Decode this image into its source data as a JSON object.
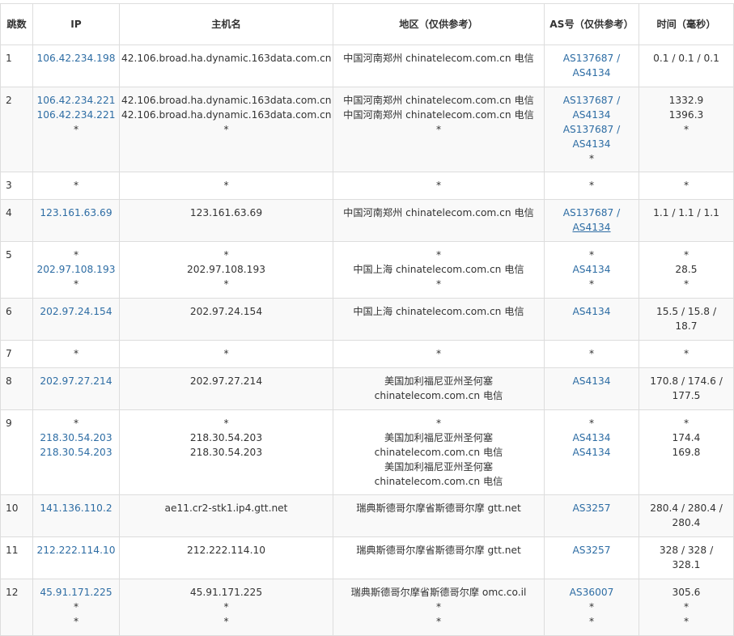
{
  "headers": {
    "hop": "跳数",
    "ip": "IP",
    "host": "主机名",
    "region": "地区（仅供参考）",
    "asn": "AS号（仅供参考）",
    "time": "时间（毫秒）"
  },
  "rows": [
    {
      "hop": "1",
      "ip": [
        "106.42.234.198"
      ],
      "host": [
        "42.106.broad.ha.dynamic.163data.com.cn"
      ],
      "region": [
        "中国河南郑州 chinatelecom.com.cn 电信"
      ],
      "asn": [
        "AS137687 /",
        "AS4134"
      ],
      "time": [
        "0.1 / 0.1 / 0.1"
      ]
    },
    {
      "hop": "2",
      "ip": [
        "106.42.234.221",
        "106.42.234.221",
        "*"
      ],
      "host": [
        "42.106.broad.ha.dynamic.163data.com.cn",
        "42.106.broad.ha.dynamic.163data.com.cn",
        "*"
      ],
      "region": [
        "中国河南郑州 chinatelecom.com.cn 电信",
        "中国河南郑州 chinatelecom.com.cn 电信",
        "*"
      ],
      "asn": [
        "AS137687 /",
        "AS4134",
        "AS137687 /",
        "AS4134",
        "*"
      ],
      "time": [
        "1332.9",
        "1396.3",
        "*"
      ]
    },
    {
      "hop": "3",
      "ip": [
        "*"
      ],
      "host": [
        "*"
      ],
      "region": [
        "*"
      ],
      "asn": [
        "*"
      ],
      "time": [
        "*"
      ]
    },
    {
      "hop": "4",
      "ip": [
        "123.161.63.69"
      ],
      "host": [
        "123.161.63.69"
      ],
      "region": [
        "中国河南郑州 chinatelecom.com.cn 电信"
      ],
      "asn": [
        "AS137687 /",
        "AS4134"
      ],
      "time": [
        "1.1 / 1.1 / 1.1"
      ]
    },
    {
      "hop": "5",
      "ip": [
        "*",
        "202.97.108.193",
        "*"
      ],
      "host": [
        "*",
        "202.97.108.193",
        "*"
      ],
      "region": [
        "*",
        "中国上海 chinatelecom.com.cn 电信",
        "*"
      ],
      "asn": [
        "*",
        "AS4134",
        "*"
      ],
      "time": [
        "*",
        "28.5",
        "*"
      ]
    },
    {
      "hop": "6",
      "ip": [
        "202.97.24.154"
      ],
      "host": [
        "202.97.24.154"
      ],
      "region": [
        "中国上海 chinatelecom.com.cn 电信"
      ],
      "asn": [
        "AS4134"
      ],
      "time": [
        "15.5 / 15.8 / 18.7"
      ]
    },
    {
      "hop": "7",
      "ip": [
        "*"
      ],
      "host": [
        "*"
      ],
      "region": [
        "*"
      ],
      "asn": [
        "*"
      ],
      "time": [
        "*"
      ]
    },
    {
      "hop": "8",
      "ip": [
        "202.97.27.214"
      ],
      "host": [
        "202.97.27.214"
      ],
      "region": [
        "美国加利福尼亚州圣何塞",
        "chinatelecom.com.cn 电信"
      ],
      "asn": [
        "AS4134"
      ],
      "time": [
        "170.8 / 174.6 / 177.5"
      ]
    },
    {
      "hop": "9",
      "ip": [
        "*",
        "218.30.54.203",
        "218.30.54.203"
      ],
      "host": [
        "*",
        "218.30.54.203",
        "218.30.54.203"
      ],
      "region": [
        "*",
        "美国加利福尼亚州圣何塞",
        "chinatelecom.com.cn 电信",
        "美国加利福尼亚州圣何塞",
        "chinatelecom.com.cn 电信"
      ],
      "asn": [
        "*",
        "AS4134",
        "AS4134"
      ],
      "time": [
        "*",
        "174.4",
        "169.8"
      ]
    },
    {
      "hop": "10",
      "ip": [
        "141.136.110.2"
      ],
      "host": [
        "ae11.cr2-stk1.ip4.gtt.net"
      ],
      "region": [
        "瑞典斯德哥尔摩省斯德哥尔摩 gtt.net"
      ],
      "asn": [
        "AS3257"
      ],
      "time": [
        "280.4 / 280.4 / 280.4"
      ]
    },
    {
      "hop": "11",
      "ip": [
        "212.222.114.10"
      ],
      "host": [
        "212.222.114.10"
      ],
      "region": [
        "瑞典斯德哥尔摩省斯德哥尔摩 gtt.net"
      ],
      "asn": [
        "AS3257"
      ],
      "time": [
        "328 / 328 / 328.1"
      ]
    },
    {
      "hop": "12",
      "ip": [
        "45.91.171.225",
        "*",
        "*"
      ],
      "host": [
        "45.91.171.225",
        "*",
        "*"
      ],
      "region": [
        "瑞典斯德哥尔摩省斯德哥尔摩 omc.co.il",
        "*",
        "*"
      ],
      "asn": [
        "AS36007",
        "*",
        "*"
      ],
      "time": [
        "305.6",
        "*",
        "*"
      ]
    }
  ],
  "colors": {
    "link": "#2e6da4",
    "border": "#dddddd",
    "stripe": "#f9f9f9"
  }
}
